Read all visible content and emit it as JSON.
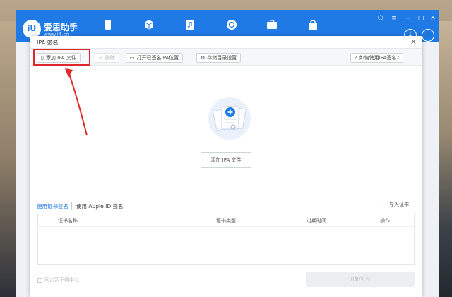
{
  "app": {
    "brand": "爱思助手",
    "brand_sub": "www.i4.cn",
    "logo_text": "iU",
    "nav_icons": [
      "phone-icon",
      "cube-icon",
      "music-file-icon",
      "refresh-icon",
      "toolbox-icon",
      "bag-icon"
    ],
    "window_controls": [
      "⬡",
      "≡",
      "—",
      "▢",
      "✕"
    ],
    "download_symbol": "↓",
    "user_symbol": "👤"
  },
  "dialog": {
    "title": "IPA 签名",
    "close": "✕"
  },
  "toolbar": {
    "add_ipa": "添加 IPA 文件",
    "delete": "删除",
    "open_signed_location": "打开已签名IPA位置",
    "storage_settings": "存储目录设置",
    "how_to": "如何使用IPA签名?"
  },
  "center": {
    "add_ipa_button": "添加 IPA 文件"
  },
  "tabs": {
    "cert_sign": "使用证书签名",
    "apple_id_sign": "使用 Apple ID 签名"
  },
  "import_cert": "导入证书",
  "table": {
    "columns": [
      "证书名称",
      "证书类型",
      "过期时间",
      "操作"
    ]
  },
  "footer": {
    "sync_label": "同步到下载中心",
    "start_sign": "开始签名"
  },
  "colors": {
    "accent": "#1f7ae6",
    "highlight": "#e02a2a"
  }
}
